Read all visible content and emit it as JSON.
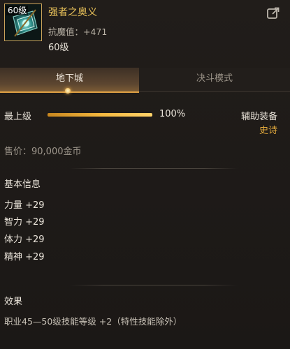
{
  "item": {
    "level_tag": "60级",
    "name": "强者之奥义",
    "stat": "抗魔值：+471",
    "level": "60级"
  },
  "tabs": [
    {
      "label": "地下城",
      "active": true
    },
    {
      "label": "决斗模式",
      "active": false
    }
  ],
  "grade": {
    "label": "最上级",
    "percent": 100,
    "percent_text": "100%"
  },
  "slot": {
    "type": "辅助装备",
    "rarity": "史诗"
  },
  "price": "售价：90,000金币",
  "basic_info": {
    "title": "基本信息",
    "attributes": [
      "力量 +29",
      "智力 +29",
      "体力 +29",
      "精神 +29"
    ]
  },
  "effect": {
    "title": "效果",
    "text": "职业45—50级技能等级 +2（特性技能除外）"
  },
  "colors": {
    "item_name": "#ebc35a",
    "rarity": "#e2a93c",
    "accent": "#e0a245"
  },
  "icons": {
    "item": "blue-gem-emblem-icon",
    "share": "external-link-icon"
  }
}
